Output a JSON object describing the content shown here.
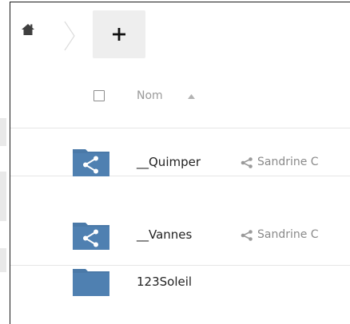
{
  "header": {
    "add_label": "+"
  },
  "table": {
    "column_name": "Nom"
  },
  "rows": [
    {
      "name": "__Quimper",
      "shared_by": "Sandrine C",
      "shared": true
    },
    {
      "name": "__Vannes",
      "shared_by": "Sandrine C",
      "shared": true
    },
    {
      "name": "123Soleil",
      "shared_by": "",
      "shared": false
    }
  ],
  "colors": {
    "folder": "#4a79a8",
    "folder_dark": "#3f6d9b",
    "icon_grey": "#3f3f3f",
    "share_grey": "#9a9a9a"
  }
}
